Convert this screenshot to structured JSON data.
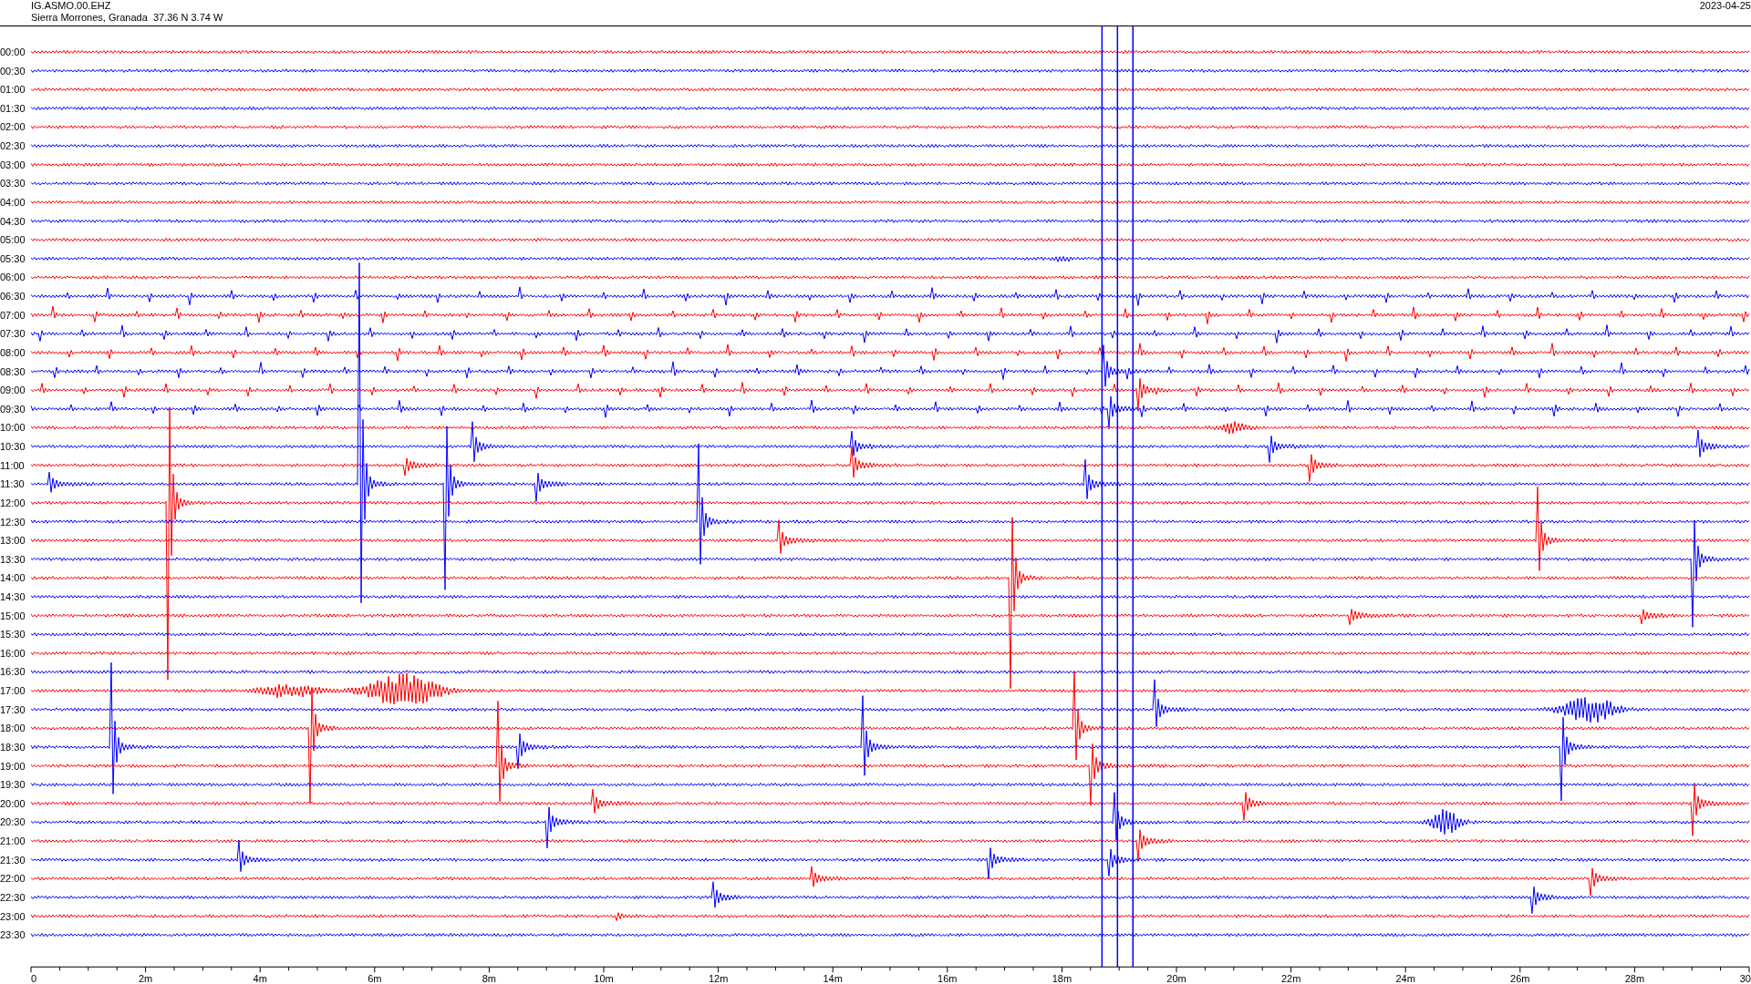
{
  "header": {
    "station": "IG.ASMO.00.EHZ",
    "location": "Sierra Morrones, Granada  37.36 N 3.74 W",
    "date": "2023-04-25"
  },
  "rows": [
    {
      "label": "00:00",
      "color": "#ff0000"
    },
    {
      "label": "00:30",
      "color": "#0000ff"
    },
    {
      "label": "01:00",
      "color": "#ff0000"
    },
    {
      "label": "01:30",
      "color": "#0000ff"
    },
    {
      "label": "02:00",
      "color": "#ff0000"
    },
    {
      "label": "02:30",
      "color": "#0000ff"
    },
    {
      "label": "03:00",
      "color": "#ff0000"
    },
    {
      "label": "03:30",
      "color": "#0000ff"
    },
    {
      "label": "04:00",
      "color": "#ff0000"
    },
    {
      "label": "04:30",
      "color": "#0000ff"
    },
    {
      "label": "05:00",
      "color": "#ff0000"
    },
    {
      "label": "05:30",
      "color": "#0000ff"
    },
    {
      "label": "06:00",
      "color": "#ff0000"
    },
    {
      "label": "06:30",
      "color": "#0000ff"
    },
    {
      "label": "07:00",
      "color": "#ff0000"
    },
    {
      "label": "07:30",
      "color": "#0000ff"
    },
    {
      "label": "08:00",
      "color": "#ff0000"
    },
    {
      "label": "08:30",
      "color": "#0000ff"
    },
    {
      "label": "09:00",
      "color": "#ff0000"
    },
    {
      "label": "09:30",
      "color": "#0000ff"
    },
    {
      "label": "10:00",
      "color": "#ff0000"
    },
    {
      "label": "10:30",
      "color": "#0000ff"
    },
    {
      "label": "11:00",
      "color": "#ff0000"
    },
    {
      "label": "11:30",
      "color": "#0000ff"
    },
    {
      "label": "12:00",
      "color": "#ff0000"
    },
    {
      "label": "12:30",
      "color": "#0000ff"
    },
    {
      "label": "13:00",
      "color": "#ff0000"
    },
    {
      "label": "13:30",
      "color": "#0000ff"
    },
    {
      "label": "14:00",
      "color": "#ff0000"
    },
    {
      "label": "14:30",
      "color": "#0000ff"
    },
    {
      "label": "15:00",
      "color": "#ff0000"
    },
    {
      "label": "15:30",
      "color": "#0000ff"
    },
    {
      "label": "16:00",
      "color": "#ff0000"
    },
    {
      "label": "16:30",
      "color": "#0000ff"
    },
    {
      "label": "17:00",
      "color": "#ff0000"
    },
    {
      "label": "17:30",
      "color": "#0000ff"
    },
    {
      "label": "18:00",
      "color": "#ff0000"
    },
    {
      "label": "18:30",
      "color": "#0000ff"
    },
    {
      "label": "19:00",
      "color": "#ff0000"
    },
    {
      "label": "19:30",
      "color": "#0000ff"
    },
    {
      "label": "20:00",
      "color": "#ff0000"
    },
    {
      "label": "20:30",
      "color": "#0000ff"
    },
    {
      "label": "21:00",
      "color": "#ff0000"
    },
    {
      "label": "21:30",
      "color": "#0000ff"
    },
    {
      "label": "22:00",
      "color": "#ff0000"
    },
    {
      "label": "22:30",
      "color": "#0000ff"
    },
    {
      "label": "23:00",
      "color": "#ff0000"
    },
    {
      "label": "23:30",
      "color": "#0000ff"
    }
  ],
  "time_axis": {
    "ticks": [
      "0",
      "2m",
      "4m",
      "6m",
      "8m",
      "10m",
      "12m",
      "14m",
      "16m",
      "18m",
      "20m",
      "22m",
      "24m",
      "26m",
      "28m",
      "30"
    ]
  }
}
